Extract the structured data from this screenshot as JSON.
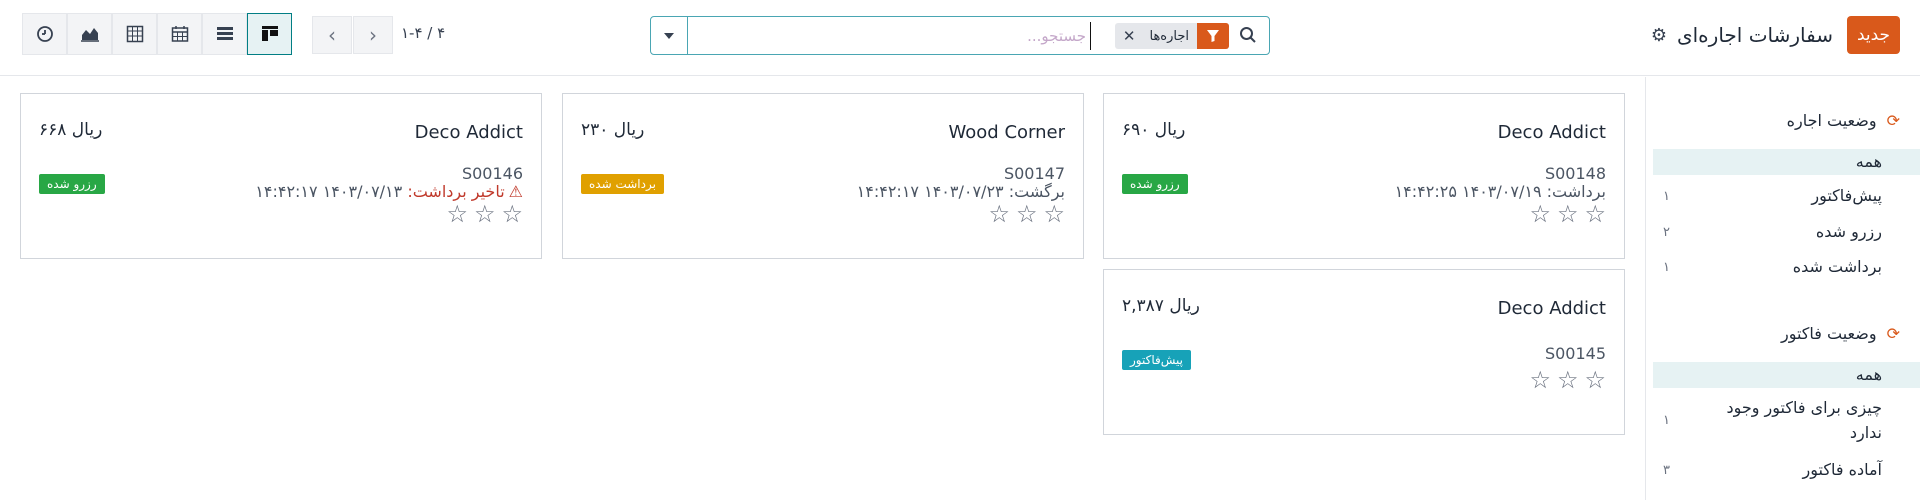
{
  "header": {
    "new_label": "جدید",
    "title": "سفارشات اجاره‌ای",
    "gear_icon": "gear-icon",
    "search": {
      "facet_label": "اجاره‌ها",
      "placeholder": "جستجو...",
      "value": ""
    },
    "pager": "۱-۴ / ۴",
    "views": [
      "kanban",
      "list",
      "calendar",
      "pivot",
      "graph",
      "activity"
    ]
  },
  "sidebar": {
    "rental_status": {
      "title": "وضعیت اجاره",
      "items": [
        {
          "label": "همه",
          "count": "",
          "selected": true
        },
        {
          "label": "پیش‌فاکتور",
          "count": "۱",
          "selected": false
        },
        {
          "label": "رزرو شده",
          "count": "۲",
          "selected": false
        },
        {
          "label": "برداشت شده",
          "count": "۱",
          "selected": false
        }
      ]
    },
    "invoice_status": {
      "title": "وضعیت فاکتور",
      "items": [
        {
          "label": "همه",
          "count": "",
          "selected": true
        },
        {
          "label": "چیزی برای فاکتور وجود ندارد",
          "count": "۱",
          "selected": false
        },
        {
          "label": "آماده فاکتور",
          "count": "۳",
          "selected": false
        }
      ]
    }
  },
  "cards": [
    {
      "partner": "Deco Addict",
      "amount": "ریال ۶۹۰",
      "ref": "S00148",
      "date_label": "برداشت:",
      "date": "۱۴۰۳/۰۷/۱۹ ۱۴:۴۲:۲۵",
      "badge": "رزرو شده",
      "badge_color": "#28a745",
      "late": false
    },
    {
      "partner": "Wood Corner",
      "amount": "ریال ۲۳۰",
      "ref": "S00147",
      "date_label": "برگشت:",
      "date": "۱۴۰۳/۰۷/۲۳ ۱۴:۴۲:۱۷",
      "badge": "برداشت شده",
      "badge_color": "#e0a000",
      "late": false
    },
    {
      "partner": "Deco Addict",
      "amount": "ریال ۶۶۸",
      "ref": "S00146",
      "date_label": "تاخیر برداشت:",
      "date": "۱۴۰۳/۰۷/۱۳ ۱۴:۴۲:۱۷",
      "badge": "رزرو شده",
      "badge_color": "#28a745",
      "late": true
    },
    {
      "partner": "Deco Addict",
      "amount": "ریال ۲,۳۸۷",
      "ref": "S00145",
      "date_label": "",
      "date": "",
      "badge": "پیش‌فاکتور",
      "badge_color": "#17a2b8",
      "late": false
    }
  ]
}
